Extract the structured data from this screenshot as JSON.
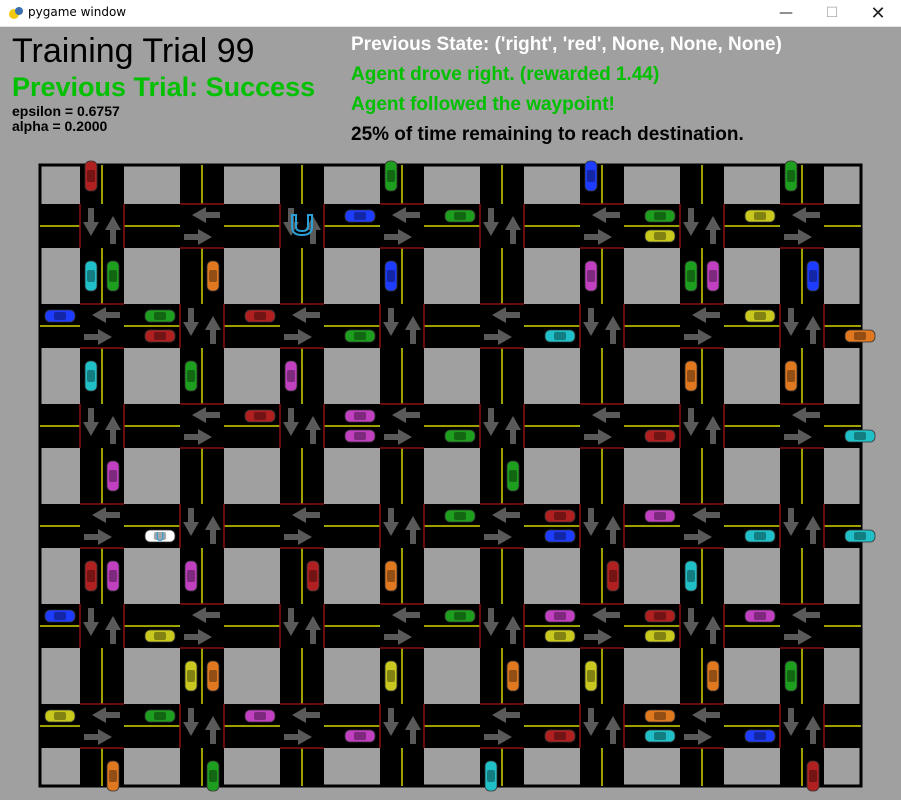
{
  "window": {
    "title": "pygame window",
    "min_glyph": "—",
    "max_glyph": "☐",
    "close_glyph": "✕"
  },
  "hud": {
    "trial": "Training Trial 99",
    "previous": "Previous Trial: Success",
    "epsilon": "epsilon = 0.6757",
    "alpha": "alpha = 0.2000",
    "state": "Previous State: ('right', 'red', None, None, None)",
    "action": "Agent drove right. (rewarded 1.44)",
    "waypoint": "Agent followed the waypoint!",
    "time": "25% of time remaining to reach destination."
  },
  "colors": {
    "background": "#a0a0a0",
    "road": "#000000",
    "block": "#a0a0a0",
    "lane_line": "#d4d400",
    "boundary": "#8b1010",
    "arrow": "#5a5a5a",
    "success": "#00c000",
    "destination": "#2a9fd6"
  },
  "grid": {
    "columns": 8,
    "rows": 6
  },
  "destination": {
    "col": 2,
    "row": 0,
    "icon": "udacity-logo-icon"
  },
  "agent": {
    "col": 1,
    "row": 3,
    "direction": "right",
    "color": "#ffffff"
  },
  "cars": [
    {
      "col": 0,
      "row": 0,
      "dir": "down",
      "color": "#b02020"
    },
    {
      "col": 2,
      "row": 0,
      "dir": "left",
      "color": "#1e3cff"
    },
    {
      "col": 3,
      "row": 0,
      "dir": "down",
      "color": "#1e9e1e"
    },
    {
      "col": 3,
      "row": 0,
      "dir": "left",
      "color": "#1e9e1e"
    },
    {
      "col": 5,
      "row": 0,
      "dir": "down",
      "color": "#1e3cff"
    },
    {
      "col": 5,
      "row": 0,
      "dir": "right",
      "color": "#c8c81e"
    },
    {
      "col": 5,
      "row": 0,
      "dir": "left",
      "color": "#1e9e1e"
    },
    {
      "col": 6,
      "row": 0,
      "dir": "left",
      "color": "#c8c81e"
    },
    {
      "col": 7,
      "row": 0,
      "dir": "down",
      "color": "#1e9e1e"
    },
    {
      "col": 0,
      "row": 1,
      "dir": "down",
      "color": "#20c0c8"
    },
    {
      "col": 0,
      "row": 1,
      "dir": "up",
      "color": "#1e9e1e"
    },
    {
      "col": 1,
      "row": 1,
      "dir": "up",
      "color": "#e07820"
    },
    {
      "col": 0,
      "row": 1,
      "dir": "right",
      "color": "#b02020"
    },
    {
      "col": 0,
      "row": 1,
      "dir": "left",
      "color": "#1e9e1e"
    },
    {
      "col": 1,
      "row": 1,
      "dir": "left",
      "color": "#b02020"
    },
    {
      "col": 3,
      "row": 1,
      "dir": "down",
      "color": "#1e3cff"
    },
    {
      "col": 2,
      "row": 1,
      "dir": "right",
      "color": "#1e9e1e"
    },
    {
      "col": 4,
      "row": 1,
      "dir": "right",
      "color": "#20c0c8"
    },
    {
      "col": 5,
      "row": 1,
      "dir": "down",
      "color": "#c040c0"
    },
    {
      "col": 6,
      "row": 1,
      "dir": "down",
      "color": "#1e9e1e"
    },
    {
      "col": 7,
      "row": 1,
      "dir": "up",
      "color": "#1e3cff"
    },
    {
      "col": 7,
      "row": 1,
      "dir": "right",
      "color": "#e07820"
    },
    {
      "col": 6,
      "row": 1,
      "dir": "left",
      "color": "#c8c81e"
    },
    {
      "col": -1,
      "row": 1,
      "dir": "left",
      "color": "#1e3cff"
    },
    {
      "col": 0,
      "row": 2,
      "dir": "down",
      "color": "#20c0c8"
    },
    {
      "col": 1,
      "row": 2,
      "dir": "down",
      "color": "#1e9e1e"
    },
    {
      "col": 2,
      "row": 2,
      "dir": "down",
      "color": "#c040c0"
    },
    {
      "col": 6,
      "row": 2,
      "dir": "down",
      "color": "#e07820"
    },
    {
      "col": 6,
      "row": 1,
      "dir": "up",
      "color": "#c040c0"
    },
    {
      "col": 7,
      "row": 2,
      "dir": "down",
      "color": "#e07820"
    },
    {
      "col": 2,
      "row": 2,
      "dir": "right",
      "color": "#c040c0"
    },
    {
      "col": 3,
      "row": 2,
      "dir": "right",
      "color": "#1e9e1e"
    },
    {
      "col": 2,
      "row": 2,
      "dir": "left",
      "color": "#c040c0"
    },
    {
      "col": 1,
      "row": 2,
      "dir": "left",
      "color": "#b02020"
    },
    {
      "col": 5,
      "row": 2,
      "dir": "right",
      "color": "#b02020"
    },
    {
      "col": 7,
      "row": 2,
      "dir": "right",
      "color": "#20c0c8"
    },
    {
      "col": 0,
      "row": 3,
      "dir": "up",
      "color": "#c040c0"
    },
    {
      "col": 4,
      "row": 3,
      "dir": "up",
      "color": "#1e9e1e"
    },
    {
      "col": 4,
      "row": 3,
      "dir": "right",
      "color": "#1e3cff"
    },
    {
      "col": 6,
      "row": 3,
      "dir": "right",
      "color": "#20c0c8"
    },
    {
      "col": 7,
      "row": 3,
      "dir": "right",
      "color": "#20c0c8"
    },
    {
      "col": 3,
      "row": 3,
      "dir": "left",
      "color": "#1e9e1e"
    },
    {
      "col": 4,
      "row": 3,
      "dir": "left",
      "color": "#b02020"
    },
    {
      "col": 5,
      "row": 3,
      "dir": "left",
      "color": "#c040c0"
    },
    {
      "col": 0,
      "row": 4,
      "dir": "down",
      "color": "#b02020"
    },
    {
      "col": 0,
      "row": 4,
      "dir": "up",
      "color": "#c040c0"
    },
    {
      "col": 1,
      "row": 4,
      "dir": "down",
      "color": "#c040c0"
    },
    {
      "col": 2,
      "row": 4,
      "dir": "up",
      "color": "#b02020"
    },
    {
      "col": 3,
      "row": 4,
      "dir": "down",
      "color": "#e07820"
    },
    {
      "col": 5,
      "row": 4,
      "dir": "up",
      "color": "#b02020"
    },
    {
      "col": 6,
      "row": 4,
      "dir": "down",
      "color": "#20c0c8"
    },
    {
      "col": 0,
      "row": 4,
      "dir": "right",
      "color": "#c8c81e"
    },
    {
      "col": -1,
      "row": 4,
      "dir": "left",
      "color": "#1e3cff"
    },
    {
      "col": 3,
      "row": 4,
      "dir": "left",
      "color": "#1e9e1e"
    },
    {
      "col": 4,
      "row": 4,
      "dir": "right",
      "color": "#c8c81e"
    },
    {
      "col": 4,
      "row": 4,
      "dir": "left",
      "color": "#c040c0"
    },
    {
      "col": 5,
      "row": 4,
      "dir": "right",
      "color": "#c8c81e"
    },
    {
      "col": 5,
      "row": 4,
      "dir": "left",
      "color": "#b02020"
    },
    {
      "col": 6,
      "row": 4,
      "dir": "left",
      "color": "#c040c0"
    },
    {
      "col": 1,
      "row": 5,
      "dir": "up",
      "color": "#e07820"
    },
    {
      "col": 1,
      "row": 5,
      "dir": "down",
      "color": "#c8c81e"
    },
    {
      "col": 3,
      "row": 5,
      "dir": "down",
      "color": "#c8c81e"
    },
    {
      "col": 4,
      "row": 5,
      "dir": "up",
      "color": "#e07820"
    },
    {
      "col": 5,
      "row": 5,
      "dir": "down",
      "color": "#c8c81e"
    },
    {
      "col": 6,
      "row": 5,
      "dir": "up",
      "color": "#e07820"
    },
    {
      "col": 7,
      "row": 5,
      "dir": "down",
      "color": "#1e9e1e"
    },
    {
      "col": 0,
      "row": 5,
      "dir": "left",
      "color": "#1e9e1e"
    },
    {
      "col": 2,
      "row": 5,
      "dir": "right",
      "color": "#c040c0"
    },
    {
      "col": 4,
      "row": 5,
      "dir": "right",
      "color": "#b02020"
    },
    {
      "col": 5,
      "row": 5,
      "dir": "right",
      "color": "#20c0c8"
    },
    {
      "col": 6,
      "row": 5,
      "dir": "right",
      "color": "#1e3cff"
    },
    {
      "col": 5,
      "row": 5,
      "dir": "left",
      "color": "#e07820"
    },
    {
      "col": -1,
      "row": 5,
      "dir": "left",
      "color": "#c8c81e"
    },
    {
      "col": 1,
      "row": 5,
      "dir": "left",
      "color": "#c040c0"
    },
    {
      "col": 0,
      "row": 6,
      "dir": "up",
      "color": "#e07820"
    },
    {
      "col": 1,
      "row": 6,
      "dir": "up",
      "color": "#1e9e1e"
    },
    {
      "col": 4,
      "row": 6,
      "dir": "down",
      "color": "#20c0c8"
    },
    {
      "col": 7,
      "row": 6,
      "dir": "up",
      "color": "#b02020"
    }
  ]
}
